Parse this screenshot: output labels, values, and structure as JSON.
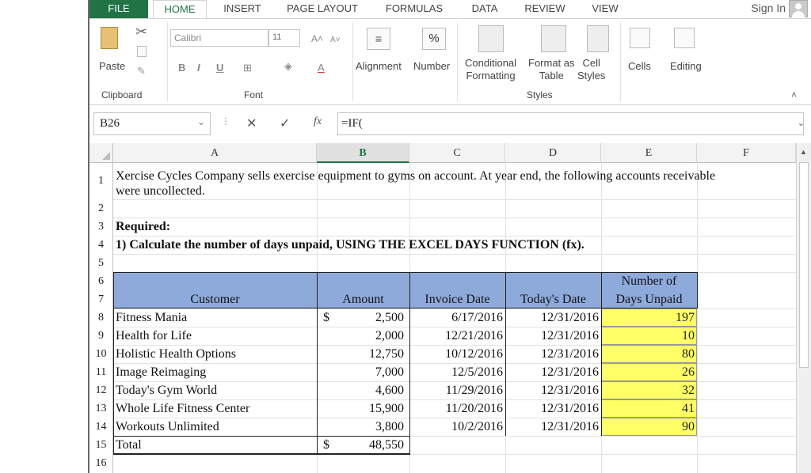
{
  "tabs": [
    "FILE",
    "HOME",
    "INSERT",
    "PAGE LAYOUT",
    "FORMULAS",
    "DATA",
    "REVIEW",
    "VIEW"
  ],
  "sign_in": "Sign In",
  "ribbon": {
    "paste": "Paste",
    "clipboard": "Clipboard",
    "font_name": "Calibri",
    "font_size": "11",
    "bold": "B",
    "italic": "I",
    "underline": "U",
    "font_group": "Font",
    "alignment": "Alignment",
    "number": "Number",
    "percent": "%",
    "conditional_1": "Conditional",
    "conditional_2": "Formatting",
    "format_table_1": "Format as",
    "format_table_2": "Table",
    "cell_styles_1": "Cell",
    "cell_styles_2": "Styles",
    "styles_group": "Styles",
    "cells": "Cells",
    "editing": "Editing"
  },
  "formula_bar": {
    "name_box": "B26",
    "fx": "fx",
    "formula": "=IF("
  },
  "columns": [
    "A",
    "B",
    "C",
    "D",
    "E",
    "F"
  ],
  "selected_column": "B",
  "rows": [
    "1",
    "2",
    "3",
    "4",
    "5",
    "6",
    "7",
    "8",
    "9",
    "10",
    "11",
    "12",
    "13",
    "14",
    "15",
    "16"
  ],
  "sheet": {
    "intro_line1": "Xercise Cycles Company sells exercise equipment to gyms on account.  At year end, the following accounts receivable",
    "intro_line2": "were uncollected.",
    "required": "Required:",
    "task": "1) Calculate the number of days unpaid, USING THE EXCEL DAYS FUNCTION (fx).",
    "headers": {
      "customer": "Customer",
      "amount": "Amount",
      "invoice_date": "Invoice Date",
      "todays_date": "Today's Date",
      "days_unpaid_1": "Number of",
      "days_unpaid_2": "Days Unpaid"
    },
    "currency": "$",
    "data_rows": [
      {
        "customer": "Fitness Mania",
        "amount": "2,500",
        "invoice": "6/17/2016",
        "today": "12/31/2016",
        "days": "197"
      },
      {
        "customer": "Health for Life",
        "amount": "2,000",
        "invoice": "12/21/2016",
        "today": "12/31/2016",
        "days": "10"
      },
      {
        "customer": "Holistic Health Options",
        "amount": "12,750",
        "invoice": "10/12/2016",
        "today": "12/31/2016",
        "days": "80"
      },
      {
        "customer": "Image Reimaging",
        "amount": "7,000",
        "invoice": "12/5/2016",
        "today": "12/31/2016",
        "days": "26"
      },
      {
        "customer": "Today's Gym World",
        "amount": "4,600",
        "invoice": "11/29/2016",
        "today": "12/31/2016",
        "days": "32"
      },
      {
        "customer": "Whole Life Fitness Center",
        "amount": "15,900",
        "invoice": "11/20/2016",
        "today": "12/31/2016",
        "days": "41"
      },
      {
        "customer": "Workouts Unlimited",
        "amount": "3,800",
        "invoice": "10/2/2016",
        "today": "12/31/2016",
        "days": "90"
      }
    ],
    "total_label": "Total",
    "total_amount": "48,550"
  },
  "colors": {
    "excel_green": "#217346",
    "header_fill": "#8eaadb",
    "highlight": "#ffff66"
  }
}
